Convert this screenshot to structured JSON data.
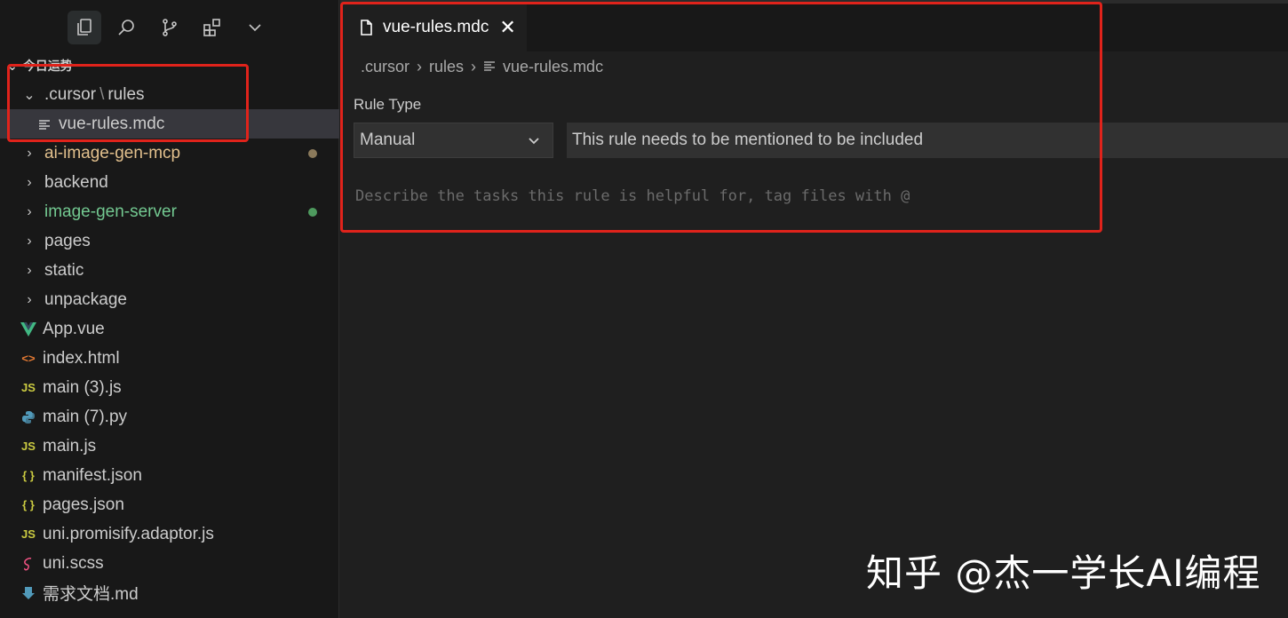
{
  "activity_bar": {
    "icons": [
      "explorer-icon",
      "search-icon",
      "source-control-icon",
      "extensions-icon",
      "chevron-down-icon"
    ]
  },
  "explorer": {
    "workspace_name": "今日运势",
    "tree": [
      {
        "label_a": ".cursor",
        "sep": "\\",
        "label_b": "rules",
        "type": "folder",
        "expanded": true
      },
      {
        "label": "vue-rules.mdc",
        "type": "file",
        "icon": "mdc-file-icon",
        "selected": true
      },
      {
        "label": "ai-image-gen-mcp",
        "type": "folder",
        "status": "modified",
        "status_color": "#8b7a5b"
      },
      {
        "label": "backend",
        "type": "folder"
      },
      {
        "label": "image-gen-server",
        "type": "folder",
        "status": "untracked",
        "status_color": "#4e9a5e"
      },
      {
        "label": "pages",
        "type": "folder"
      },
      {
        "label": "static",
        "type": "folder"
      },
      {
        "label": "unpackage",
        "type": "folder"
      },
      {
        "label": "App.vue",
        "type": "file",
        "icon": "vue-icon"
      },
      {
        "label": "index.html",
        "type": "file",
        "icon": "html-icon"
      },
      {
        "label": "main (3).js",
        "type": "file",
        "icon": "js-icon"
      },
      {
        "label": "main (7).py",
        "type": "file",
        "icon": "python-icon"
      },
      {
        "label": "main.js",
        "type": "file",
        "icon": "js-icon"
      },
      {
        "label": "manifest.json",
        "type": "file",
        "icon": "json-icon"
      },
      {
        "label": "pages.json",
        "type": "file",
        "icon": "json-icon"
      },
      {
        "label": "uni.promisify.adaptor.js",
        "type": "file",
        "icon": "js-icon"
      },
      {
        "label": "uni.scss",
        "type": "file",
        "icon": "scss-icon"
      },
      {
        "label": "需求文档.md",
        "type": "file",
        "icon": "markdown-icon"
      }
    ]
  },
  "editor": {
    "tab": {
      "label": "vue-rules.mdc",
      "close": "✕"
    },
    "breadcrumb": [
      ".cursor",
      "rules",
      "vue-rules.mdc"
    ],
    "rule_type_label": "Rule Type",
    "rule_type_value": "Manual",
    "rule_type_description": "This rule needs to be mentioned to be included",
    "description_placeholder": "Describe the tasks this rule is helpful for, tag files with @"
  },
  "icon_glyphs": {
    "js": "JS",
    "json": "{ }",
    "html": "<>"
  },
  "watermark": "知乎 @杰一学长AI编程",
  "colors": {
    "highlight_box": "#e0231b",
    "selected_row": "#37373d",
    "sidebar_bg": "#181818",
    "editor_bg": "#1f1f1f"
  }
}
